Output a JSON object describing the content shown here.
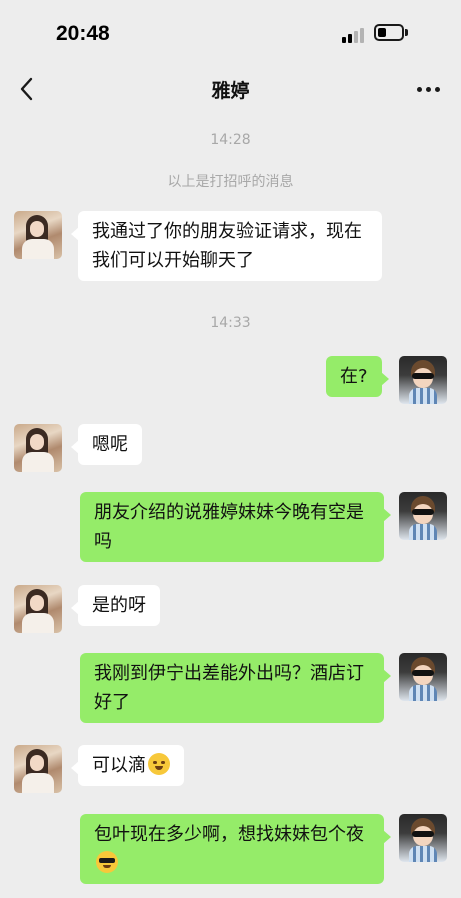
{
  "status_bar": {
    "time": "20:48"
  },
  "header": {
    "title": "雅婷"
  },
  "chat": {
    "timestamps": [
      "14:28",
      "14:33"
    ],
    "system_note": "以上是打招呼的消息",
    "messages": [
      {
        "from": "her",
        "text": "我通过了你的朋友验证请求，现在我们可以开始聊天了"
      },
      {
        "from": "me",
        "text": "在?"
      },
      {
        "from": "her",
        "text": "嗯呢"
      },
      {
        "from": "me",
        "text": "朋友介绍的说雅婷妹妹今晚有空是吗"
      },
      {
        "from": "her",
        "text": "是的呀"
      },
      {
        "from": "me",
        "text": "我刚到伊宁出差能外出吗？酒店订好了"
      },
      {
        "from": "her",
        "text": "可以滴",
        "emoji": "smiling-face-emoji"
      },
      {
        "from": "me",
        "text": "包叶现在多少啊，想找妹妹包个夜",
        "emoji": "sunglasses-face-emoji"
      }
    ]
  },
  "colors": {
    "background": "#ededed",
    "bubble_incoming": "#ffffff",
    "bubble_outgoing": "#95ec69",
    "meta_text": "#a8a8a8"
  },
  "icons": [
    "back-icon",
    "more-icon",
    "signal-icon",
    "battery-icon"
  ]
}
